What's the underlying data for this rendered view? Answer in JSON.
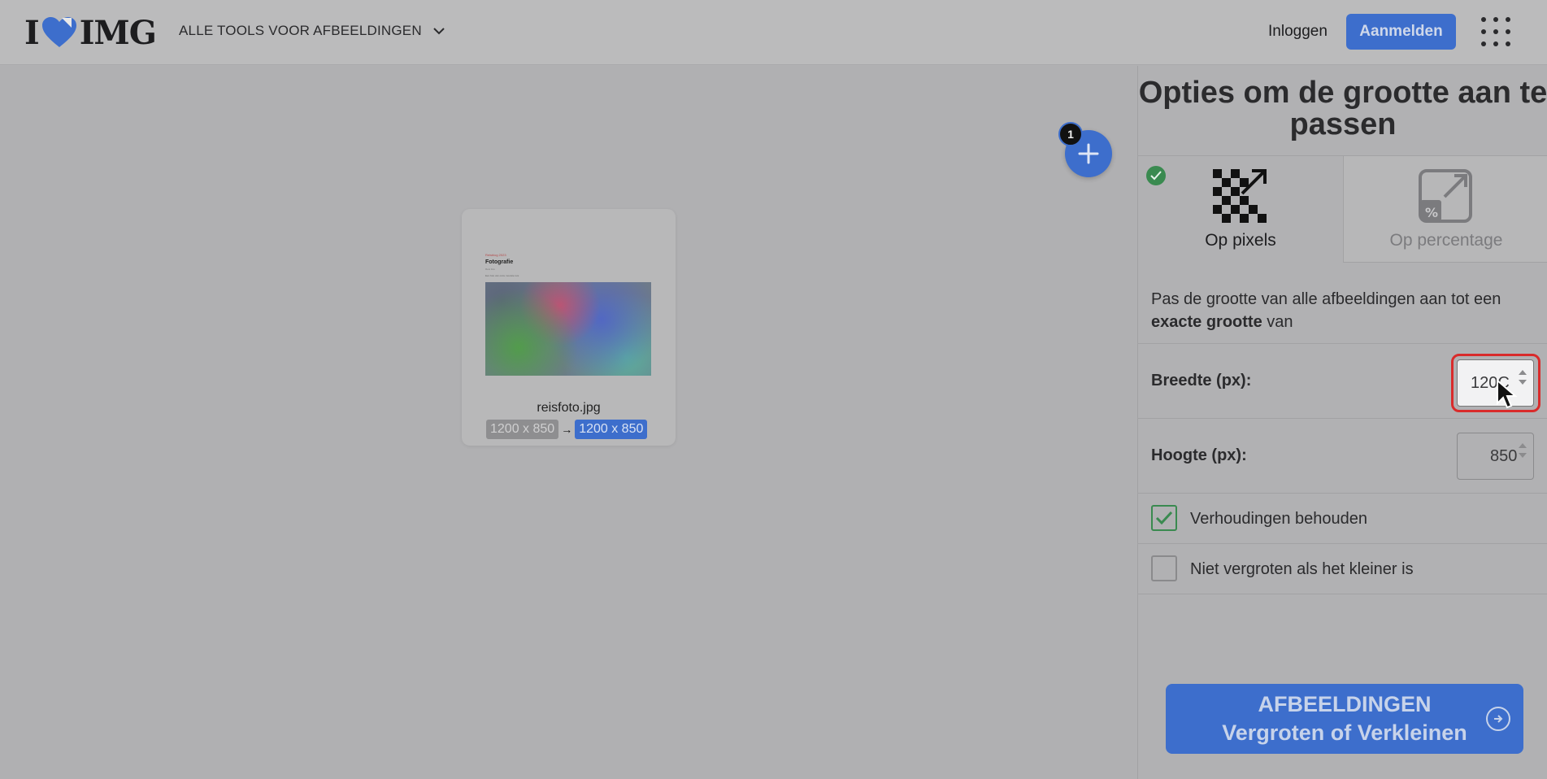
{
  "header": {
    "logo": {
      "left": "I",
      "right": "IMG",
      "heart_icon": "heart-icon",
      "color": "#3d6ecc"
    },
    "tools_menu_label": "ALLE TOOLS VOOR AFBEELDINGEN",
    "login_label": "Inloggen",
    "signup_label": "Aanmelden",
    "apps_icon": "grid-menu-icon"
  },
  "workspace": {
    "file": {
      "name": "reisfoto.jpg",
      "original_size": "1200 x 850",
      "new_size": "1200 x 850",
      "arrow": "→",
      "preview": {
        "small_text": "Reisblog 2023",
        "title": "Fotografie",
        "subtitle": "Reis foto",
        "line": "Een foto van onze mooiste reis"
      }
    },
    "file_count": "1",
    "add_icon": "plus-icon"
  },
  "sidebar": {
    "title": "Opties om de grootte aan te passen",
    "tabs": [
      {
        "label": "Op pixels",
        "active": true
      },
      {
        "label": "Op percentage",
        "active": false
      }
    ],
    "description_pre": "Pas de grootte van alle afbeeldingen aan tot een ",
    "description_bold": "exacte grootte",
    "description_post": " van",
    "width_label": "Breedte (px):",
    "width_value": "120C",
    "height_label": "Hoogte (px):",
    "height_value": "850",
    "keep_ratio_label": "Verhoudingen behouden",
    "keep_ratio_checked": true,
    "no_enlarge_label": "Niet vergroten als het kleiner is",
    "no_enlarge_checked": false,
    "submit_line1": "AFBEELDINGEN",
    "submit_line2": "Vergroten of Verkleinen"
  },
  "colors": {
    "accent": "#3d6ecc",
    "check_green": "#3a8a50",
    "focus_red": "#d92b2b"
  }
}
